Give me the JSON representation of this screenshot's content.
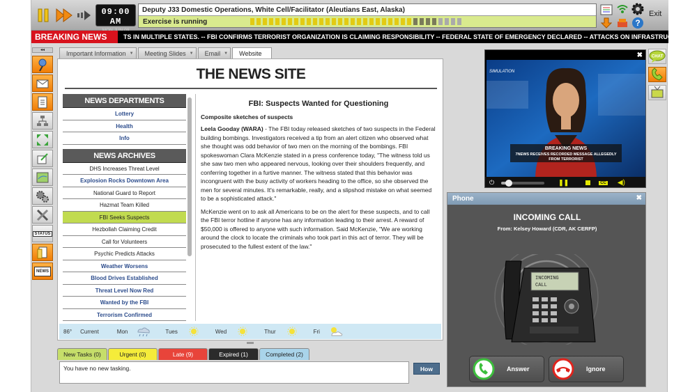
{
  "clock": {
    "time": "09:00 AM",
    "date": "MON JUN 09"
  },
  "exercise": {
    "title": "Deputy J33 Domestic Operations, White Cell/Facilitator (Aleutians East, Alaska)",
    "status": "Exercise is running",
    "segments_done": 30,
    "segments_total": 34
  },
  "exit_label": "Exit",
  "ticker": {
    "label": "BREAKING NEWS",
    "text": "TS IN MULTIPLE STATES. -- FBI CONFIRMS TERRORIST ORGANIZATION IS CLAIMING RESPONSIBILITY -- FEDERAL STATE OF EMERGENCY DECLARED -- ATTACKS ON INFRASTRUCTURE TARGETS IN MULTIPLE STATES. -- FBI CONF"
  },
  "left_icons": [
    "pushpin-icon",
    "mail-icon",
    "checklist-icon",
    "org-chart-icon",
    "expand-arrows-icon",
    "edit-note-icon",
    "map-icon",
    "gears-icon",
    "tools-icon",
    "status-icon",
    "document-icon",
    "news-icon"
  ],
  "left_icon_labels": {
    "status": "STATUS",
    "news": "NEWS"
  },
  "tabs": [
    {
      "label": "Important Information"
    },
    {
      "label": "Meeting Slides"
    },
    {
      "label": "Email"
    },
    {
      "label": "Website"
    }
  ],
  "site": {
    "title": "THE NEWS SITE",
    "departments_heading": "NEWS DEPARTMENTS",
    "departments": [
      "Lottery",
      "Health",
      "Info"
    ],
    "archives_heading": "NEWS ARCHIVES",
    "archives": [
      {
        "label": "DHS Increases Threat Level",
        "style": "plain"
      },
      {
        "label": "Explosion Rocks Downtown Area",
        "style": "blue"
      },
      {
        "label": "National Guard to Report",
        "style": "plain"
      },
      {
        "label": "Hazmat Team Killed",
        "style": "plain"
      },
      {
        "label": "FBI Seeks Suspects",
        "style": "sel"
      },
      {
        "label": "Hezbollah Claiming Credit",
        "style": "plain"
      },
      {
        "label": "Call for Volunteers",
        "style": "plain"
      },
      {
        "label": "Psychic Predicts Attacks",
        "style": "plain"
      },
      {
        "label": "Weather Worsens",
        "style": "blue"
      },
      {
        "label": "Blood Drives Established",
        "style": "blue"
      },
      {
        "label": "Threat Level Now Red",
        "style": "blue"
      },
      {
        "label": "Wanted by the FBI",
        "style": "blue"
      },
      {
        "label": "Terrorism Confirmed",
        "style": "blue"
      }
    ],
    "article": {
      "headline": "FBI: Suspects Wanted for Questioning",
      "subhead": "Composite sketches of suspects",
      "byline": "Leela Gooday (WARA)",
      "p1": " - The FBI today released sketches of two suspects in the Federal building bombings. Investigators received a tip from an alert citizen who observed what she thought was odd behavior of two men on the morning of the bombings. FBI spokeswoman Clara McKenzie stated in a press conference today, \"The witness told us she saw two men who appeared nervous, looking over their shoulders frequently, and conferring together in a furtive manner. The witness stated that this behavior was incongruent with the busy activity of workers heading to the office, so she observed the men for several minutes. It's remarkable, really, and a slipshod mistake on what seemed to be a sophisticated attack.\"",
      "p2": "McKenzie went on to ask all Americans to be on the alert for these suspects, and to call the FBI terror hotline if anyone has any information leading to their arrest. A reward of $50,000 is offered to anyone with such information. Said McKenzie, \"We are working around the clock to locate the criminals who took part in this act of terror. They will be prosecuted to the fullest extent of the law.\""
    },
    "weather": {
      "temp": "86°",
      "current": "Current",
      "days": [
        {
          "day": "Mon",
          "icon": "rain-icon"
        },
        {
          "day": "Tues",
          "icon": "sun-icon"
        },
        {
          "day": "Wed",
          "icon": "sun-icon"
        },
        {
          "day": "Thur",
          "icon": "sun-icon"
        },
        {
          "day": "Fri",
          "icon": "partly-cloudy-icon"
        }
      ]
    }
  },
  "tasks": {
    "tabs": [
      {
        "label": "New Tasks (0)",
        "bg": "#c6de6a",
        "fg": "#222"
      },
      {
        "label": "Urgent (0)",
        "bg": "#f5ec3a",
        "fg": "#222"
      },
      {
        "label": "Late (9)",
        "bg": "#e8443a",
        "fg": "#fff"
      },
      {
        "label": "Expired (1)",
        "bg": "#2b2b2b",
        "fg": "#fff"
      },
      {
        "label": "Completed (2)",
        "bg": "#a9d4ea",
        "fg": "#222"
      }
    ],
    "message": "You have no new tasking.",
    "how_label": "How"
  },
  "video": {
    "channel": "SIMULATION",
    "banner": "BREAKING NEWS",
    "caption1": "7NEWS RECEIVES RECORDED MESSAGE ALLEGEDLY",
    "caption2": "FROM TERRORIST",
    "progress": 0.18
  },
  "phone": {
    "title": "Phone",
    "heading": "INCOMING CALL",
    "from": "From: Kelsey Howard (CDR, AK CERFP)",
    "screen_line1": "INCOMING",
    "screen_line2": "CALL",
    "answer_label": "Answer",
    "ignore_label": "Ignore"
  },
  "right_icons": {
    "chat_label": "CHAT"
  },
  "colors": {
    "accent": "#f08a12",
    "breaking": "#d8121d",
    "running": "#d9ea8e",
    "selected": "#c1db50"
  }
}
